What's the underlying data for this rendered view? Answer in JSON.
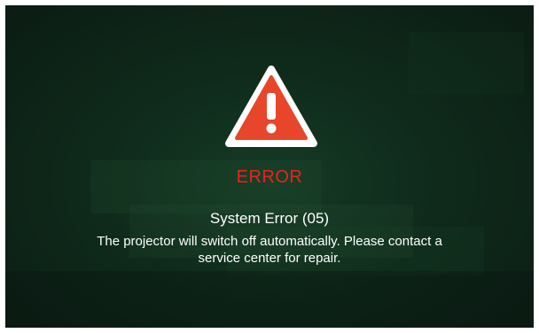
{
  "dialog": {
    "icon": "warning-triangle-icon",
    "title": "ERROR",
    "code": "System Error (05)",
    "message": "The projector will switch off automatically. Please contact a service center for repair."
  },
  "colors": {
    "background": "#0d2016",
    "title": "#e8241c",
    "icon_fill": "#e8462a",
    "icon_outline": "#ffffff",
    "text": "#ffffff"
  }
}
